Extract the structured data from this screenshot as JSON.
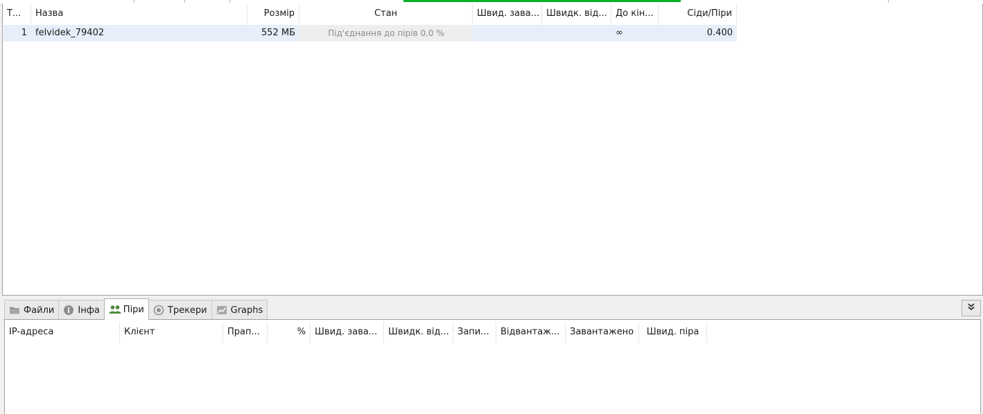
{
  "torrent_list": {
    "columns": [
      "Т...",
      "Назва",
      "Розмір",
      "Стан",
      "Швид. зава...",
      "Швидк. від...",
      "До кін...",
      "Сіди/Піри"
    ],
    "rows": [
      {
        "index": "1",
        "name": "felvidek_79402",
        "size": "552 МБ",
        "status": "Під'єднання до пірів 0.0 %",
        "download_speed": "",
        "upload_speed": "",
        "eta": "∞",
        "ratio": "0.400"
      }
    ]
  },
  "tabs": [
    {
      "label": "Файли",
      "icon": "folder-icon"
    },
    {
      "label": "Інфа",
      "icon": "info-icon"
    },
    {
      "label": "Піри",
      "icon": "peers-icon"
    },
    {
      "label": "Трекери",
      "icon": "tracker-icon"
    },
    {
      "label": "Graphs",
      "icon": "graph-icon"
    }
  ],
  "active_tab": "Піри",
  "collapse_button": {
    "icon": "double-chevron-down-icon"
  },
  "peers": {
    "columns": [
      "IP-адреса",
      "Клієнт",
      "Прап...",
      "%",
      "Швид. зава...",
      "Швидк. від...",
      "Запи...",
      "Відвантаж...",
      "Завантажено",
      "Швид. піра"
    ]
  },
  "colors": {
    "selection_row": "#e6eef9",
    "status_cell": "#eeeeee",
    "status_text": "#8a8a8a",
    "peers_icon": "#4f8a3a",
    "progress_green": "#06b025"
  }
}
